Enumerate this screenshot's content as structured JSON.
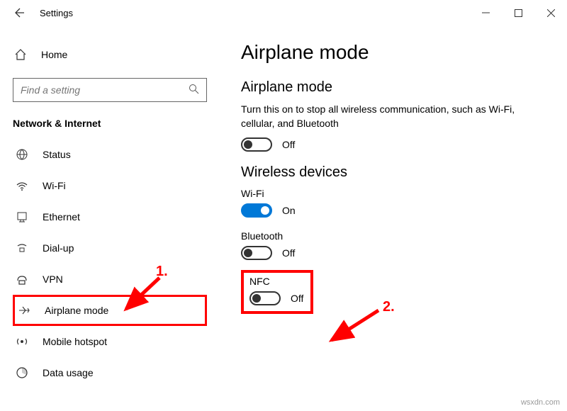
{
  "titlebar": {
    "title": "Settings"
  },
  "sidebar": {
    "home": "Home",
    "search_placeholder": "Find a setting",
    "section": "Network & Internet",
    "items": [
      {
        "label": "Status"
      },
      {
        "label": "Wi-Fi"
      },
      {
        "label": "Ethernet"
      },
      {
        "label": "Dial-up"
      },
      {
        "label": "VPN"
      },
      {
        "label": "Airplane mode"
      },
      {
        "label": "Mobile hotspot"
      },
      {
        "label": "Data usage"
      }
    ]
  },
  "content": {
    "h1": "Airplane mode",
    "airplane": {
      "heading": "Airplane mode",
      "desc": "Turn this on to stop all wireless communication, such as Wi-Fi, cellular, and Bluetooth",
      "state": "Off"
    },
    "wireless_heading": "Wireless devices",
    "wifi": {
      "label": "Wi-Fi",
      "state": "On"
    },
    "bluetooth": {
      "label": "Bluetooth",
      "state": "Off"
    },
    "nfc": {
      "label": "NFC",
      "state": "Off"
    }
  },
  "annotations": {
    "one": "1.",
    "two": "2."
  },
  "watermark": "wsxdn.com"
}
